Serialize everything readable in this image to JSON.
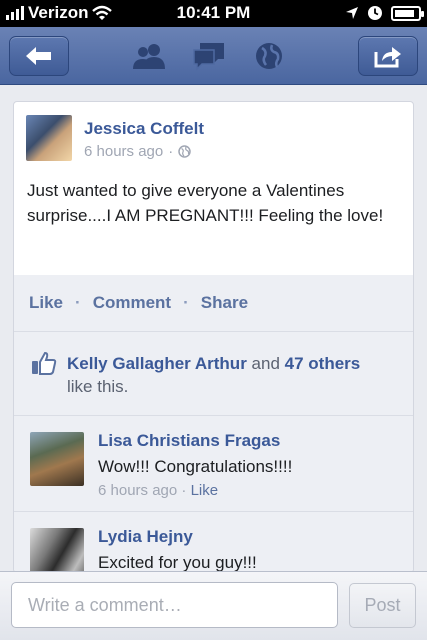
{
  "status_bar": {
    "carrier": "Verizon",
    "time": "10:41 PM",
    "signal_bars": 4,
    "battery_level": 0.85
  },
  "nav_bar": {
    "back_icon": "back-arrow-icon",
    "friends_icon": "friends-icon",
    "messages_icon": "messages-icon",
    "notifications_icon": "globe-icon",
    "share_icon": "share-icon",
    "background_color": "#4a66a0"
  },
  "post": {
    "author": "Jessica Coffelt",
    "time": "6 hours ago",
    "separator": "·",
    "privacy_icon": "public-globe-icon",
    "text": "Just wanted to give everyone a Valentines surprise....I AM PREGNANT!!! Feeling the love!"
  },
  "actions": {
    "like": "Like",
    "comment": "Comment",
    "share": "Share",
    "separator": "·"
  },
  "likes": {
    "name": "Kelly Gallagher Arthur",
    "conjunction": "and",
    "others": "47 others",
    "suffix": "like this."
  },
  "comments": [
    {
      "author": "Lisa Christians Fragas",
      "text": "Wow!!! Congratulations!!!!",
      "time": "6 hours ago",
      "separator": "·",
      "like": "Like"
    },
    {
      "author": "Lydia Hejny",
      "text": "Excited for you guy!!!"
    }
  ],
  "composer": {
    "placeholder": "Write a comment…",
    "post_label": "Post"
  },
  "colors": {
    "accent": "#3b5998",
    "link": "#5b72a0"
  }
}
